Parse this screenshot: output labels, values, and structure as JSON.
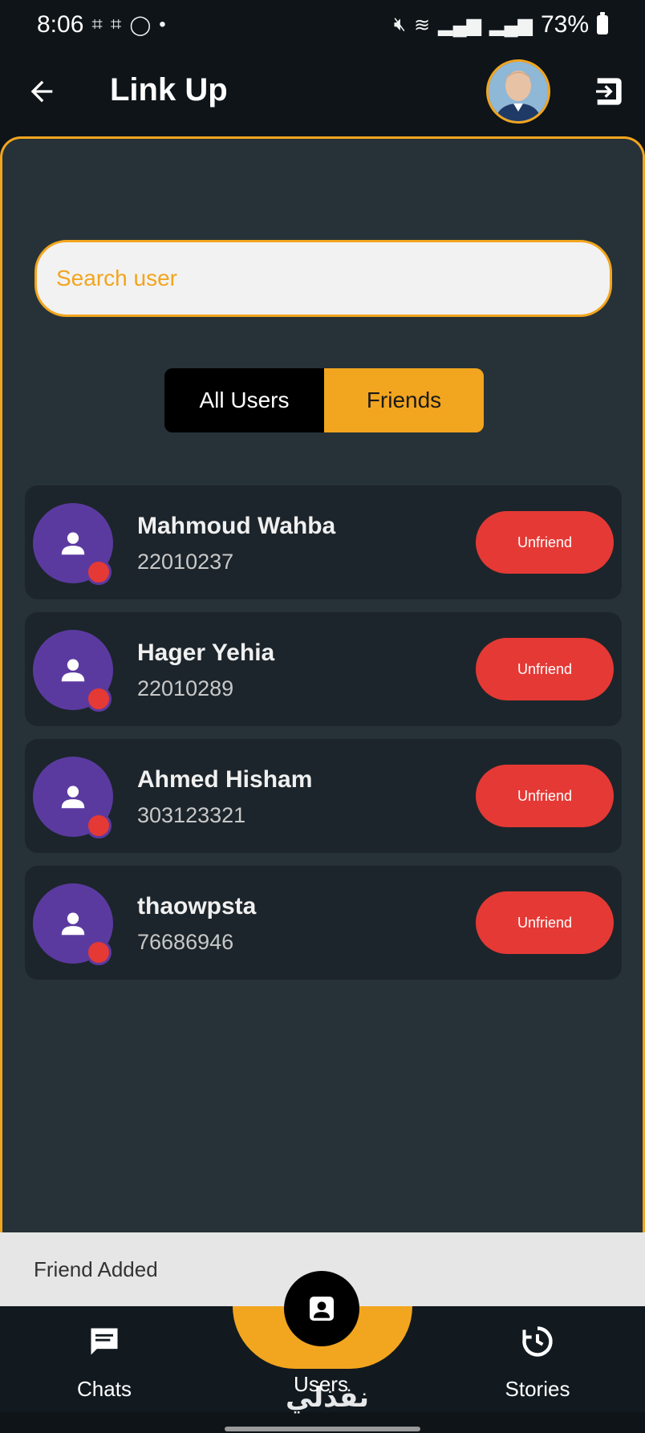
{
  "status_bar": {
    "time": "8:06",
    "battery": "73%"
  },
  "app_bar": {
    "title": "Link Up"
  },
  "search": {
    "placeholder": "Search user",
    "value": ""
  },
  "toggle": {
    "all_users": "All Users",
    "friends": "Friends",
    "selected": "Friends"
  },
  "users": [
    {
      "name": "Mahmoud Wahba",
      "id": "22010237",
      "action": "Unfriend"
    },
    {
      "name": "Hager Yehia",
      "id": "22010289",
      "action": "Unfriend"
    },
    {
      "name": "Ahmed Hisham",
      "id": "303123321",
      "action": "Unfriend"
    },
    {
      "name": "thaowpsta",
      "id": "76686946",
      "action": "Unfriend"
    }
  ],
  "snackbar": {
    "message": "Friend Added"
  },
  "bottom_nav": {
    "chats": "Chats",
    "users": "Users",
    "stories": "Stories",
    "active": "Users"
  },
  "watermark": "نفذلي",
  "colors": {
    "accent": "#f2a51e",
    "panel": "#263238",
    "card": "#1c252b",
    "danger": "#e53935",
    "avatar_bg": "#5b3aa0"
  }
}
